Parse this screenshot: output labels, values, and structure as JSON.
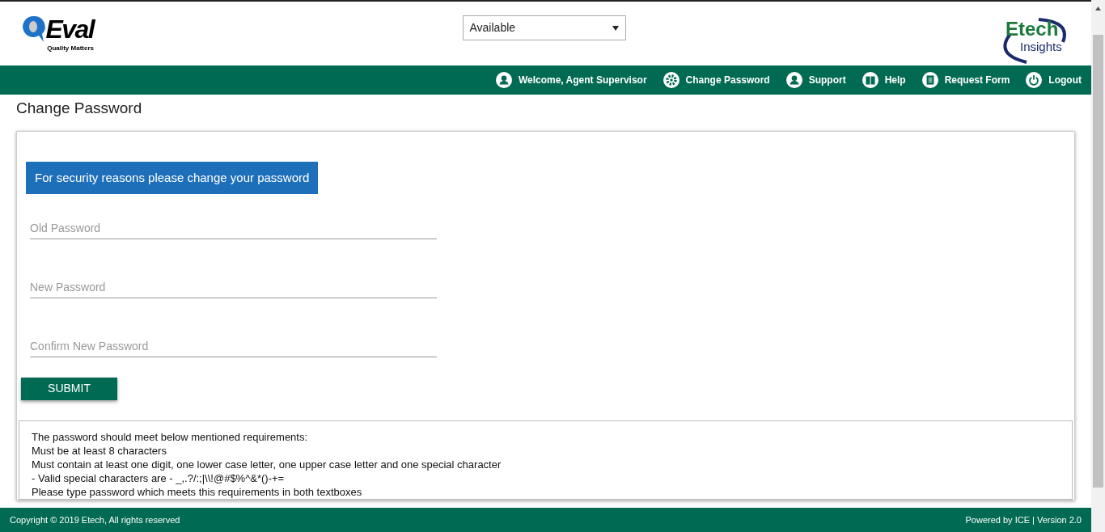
{
  "header": {
    "logo": {
      "word": "Eval",
      "tagline": "Quality Matters"
    },
    "status_select": {
      "value": "Available"
    },
    "partner_logo": {
      "word": "Etech",
      "sub": "Insights"
    }
  },
  "nav": [
    {
      "label": "Welcome, Agent Supervisor",
      "kind": "user"
    },
    {
      "label": "Change Password",
      "kind": "gear"
    },
    {
      "label": "Support",
      "kind": "user"
    },
    {
      "label": "Help",
      "kind": "book"
    },
    {
      "label": "Request Form",
      "kind": "clipboard"
    },
    {
      "label": "Logout",
      "kind": "power"
    }
  ],
  "page_title": "Change Password",
  "banner": "For security reasons please change your password",
  "fields": [
    {
      "placeholder": "Old Password"
    },
    {
      "placeholder": "New Password"
    },
    {
      "placeholder": "Confirm New Password"
    }
  ],
  "submit": "SUBMIT",
  "requirements": [
    "The password should meet below mentioned requirements:",
    "Must be at least 8 characters",
    "Must contain at least one digit, one lower case letter, one upper case letter and one special character",
    "- Valid special characters are - _,.?/:;|\\\\!@#$%^&*()-+=",
    "Please type password which meets this requirements in both textboxes"
  ],
  "footer": {
    "left": "Copyright © 2019 Etech, All rights reserved",
    "right": "Powered by ICE | Version 2.0"
  }
}
